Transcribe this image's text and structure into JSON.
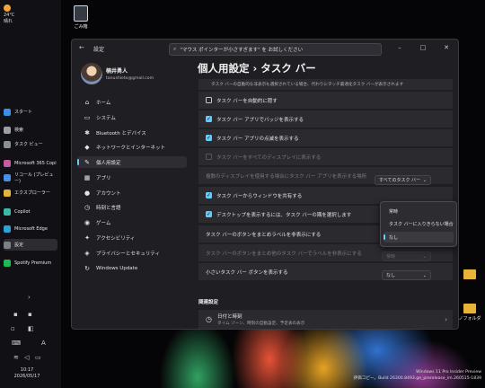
{
  "taskbar": {
    "weather": {
      "temp": "24°C",
      "cond": "晴れ"
    },
    "items": [
      {
        "label": "スタート",
        "color": "#3a8ee6"
      },
      {
        "label": "検索",
        "color": "#9aa0a6"
      },
      {
        "label": "タスク ビュー",
        "color": "#8a8f96"
      },
      {
        "label": "Microsoft 365 Copi",
        "color": "#c85aa0"
      },
      {
        "label": "リコール (プレビュー)",
        "color": "#4a90e2"
      },
      {
        "label": "エクスプローラー",
        "color": "#e7b43a"
      },
      {
        "label": "Copilot",
        "color": "#3fb8a8"
      },
      {
        "label": "Microsoft Edge",
        "color": "#2fa0d8"
      },
      {
        "label": "設定",
        "color": "#7a7f88"
      },
      {
        "label": "Spotify Premium",
        "color": "#1db954"
      }
    ],
    "expand": "›",
    "tray_letter": "A",
    "time": "10:17",
    "date": "2026/05/17"
  },
  "desktop": {
    "recycle_label": "ごみ箱",
    "folder_label": "ノフォルダ",
    "watermark_line1": "Windows 11 Pro Insider Preview",
    "watermark_line2": "評価コピー。Build 26300.8493.ge_prerelease_im.260515-1839"
  },
  "window": {
    "title": "設定",
    "search_text": "\"マウス ポインターが小さすぎます\" を お試しください",
    "profile_name": "楠井勇人",
    "profile_email": "tanushieto@gmail.com",
    "nav": [
      {
        "label": "ホーム",
        "icon": "⌂"
      },
      {
        "label": "システム",
        "icon": "▭"
      },
      {
        "label": "Bluetooth とデバイス",
        "icon": "✱"
      },
      {
        "label": "ネットワークとインターネット",
        "icon": "◆"
      },
      {
        "label": "個人用設定",
        "icon": "✎"
      },
      {
        "label": "アプリ",
        "icon": "▦"
      },
      {
        "label": "アカウント",
        "icon": "●"
      },
      {
        "label": "時刻と言語",
        "icon": "◷"
      },
      {
        "label": "ゲーム",
        "icon": "◉"
      },
      {
        "label": "アクセシビリティ",
        "icon": "✦"
      },
      {
        "label": "プライバシーとセキュリティ",
        "icon": "◈"
      },
      {
        "label": "Windows Update",
        "icon": "↻"
      }
    ],
    "heading": "個人用設定 › タスク バー",
    "rows": [
      {
        "label": "タスク バーの自動的な非表示も選択されている場合、代わりにタッチ最適化タスク バーが表示されます",
        "type": "note"
      },
      {
        "label": "タスク バーを自動的に隠す",
        "check": "off"
      },
      {
        "label": "タスク バー アプリでバッジを表示する",
        "check": "on"
      },
      {
        "label": "タスク バー アプリの点滅を表示する",
        "check": "on"
      },
      {
        "label": "タスク バーをすべてのディスプレイに表示する",
        "check": "dis"
      },
      {
        "label": "複数のディスプレイを使用する場合にタスク バー アプリを表示する場所",
        "check": "none",
        "value": "すべてのタスク バー",
        "dim": true
      },
      {
        "label": "タスク バーからウィンドウを共有する",
        "check": "on"
      },
      {
        "label": "デスクトップを表示するには、タスク バーの隅を選択します",
        "check": "on"
      },
      {
        "label": "タスク バーのボタンをまとめラベルを非表示にする",
        "check": "none"
      },
      {
        "label": "タスク バーのボタンをまとめ他のタスク バーでラベルを非表示にする",
        "check": "none",
        "value": "常時",
        "dim": true
      },
      {
        "label": "小さいタスク バー ボタンを表示する",
        "check": "none",
        "value": "なし"
      }
    ],
    "popup": [
      "常時",
      "タスク バーに入りきらない場合",
      "なし"
    ],
    "related_title": "関連設定",
    "related_item": {
      "title": "日付と時刻",
      "subtitle": "タイム ゾーン、時刻の自動設定、予定表の表示"
    }
  }
}
